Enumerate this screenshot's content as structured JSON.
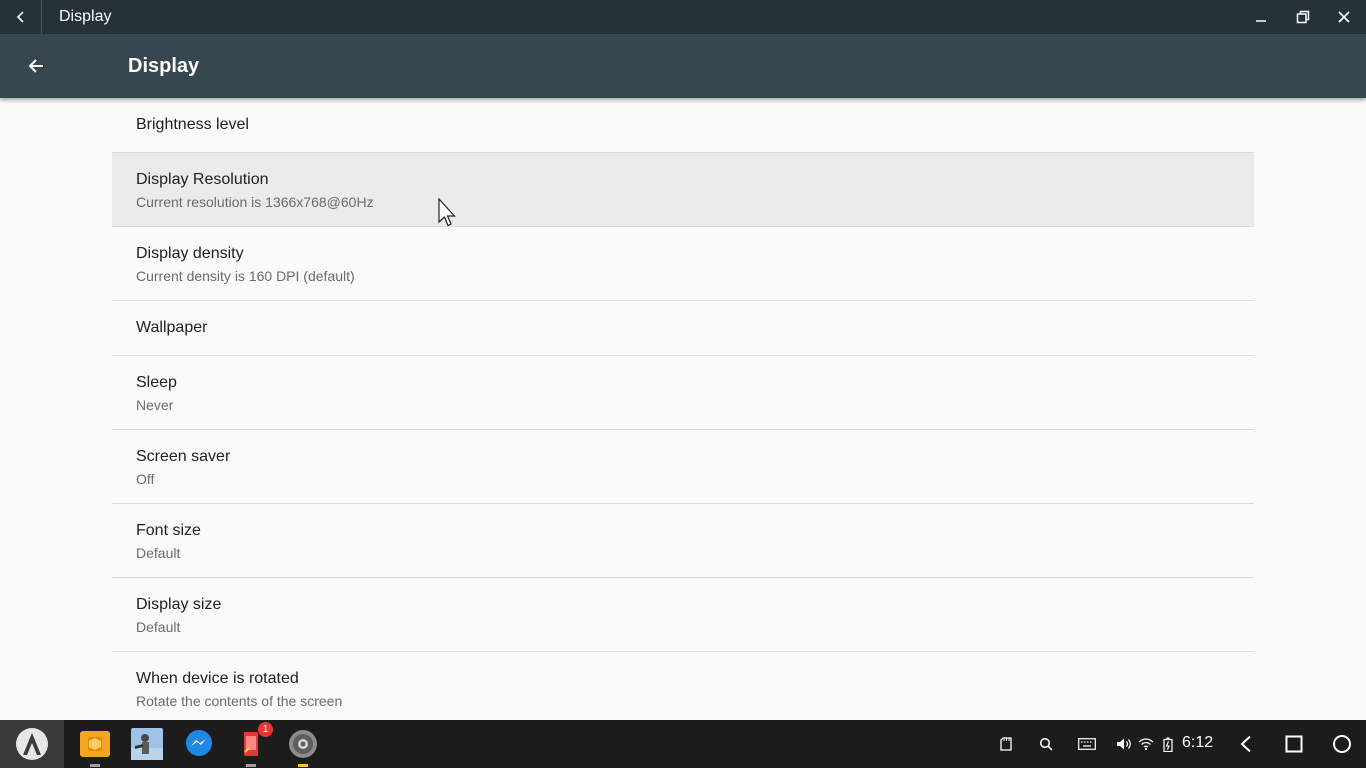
{
  "window": {
    "title": "Display",
    "back_icon": "chevron-left-icon",
    "minimize_icon": "minimize-icon",
    "restore_icon": "restore-icon",
    "close_icon": "close-icon"
  },
  "appbar": {
    "title": "Display",
    "up_icon": "arrow-back-icon"
  },
  "settings": [
    {
      "title": "Brightness level",
      "summary": ""
    },
    {
      "title": "Display Resolution",
      "summary": "Current resolution is 1366x768@60Hz"
    },
    {
      "title": "Display density",
      "summary": "Current density is 160 DPI (default)"
    },
    {
      "title": "Wallpaper",
      "summary": ""
    },
    {
      "title": "Sleep",
      "summary": "Never"
    },
    {
      "title": "Screen saver",
      "summary": "Off"
    },
    {
      "title": "Font size",
      "summary": "Default"
    },
    {
      "title": "Display size",
      "summary": "Default"
    },
    {
      "title": "When device is rotated",
      "summary": "Rotate the contents of the screen"
    }
  ],
  "taskbar": {
    "start_icon": "launcher-icon",
    "apps": [
      {
        "name": "files-app-icon"
      },
      {
        "name": "game-app-icon"
      },
      {
        "name": "messenger-app-icon"
      },
      {
        "name": "notes-app-icon",
        "badge": "1"
      },
      {
        "name": "settings-app-icon"
      }
    ],
    "tray": [
      "storage-icon",
      "search-icon",
      "keyboard-icon",
      "volume-icon",
      "wifi-icon",
      "battery-icon"
    ],
    "clock": "6:12",
    "nav": [
      "back-nav-icon",
      "recents-nav-icon",
      "home-nav-icon"
    ]
  },
  "colors": {
    "titlebar": "#263238",
    "appbar": "#37474f",
    "background": "#fafafa",
    "highlight": "#ebebeb",
    "taskbar": "#1c1c1c"
  }
}
